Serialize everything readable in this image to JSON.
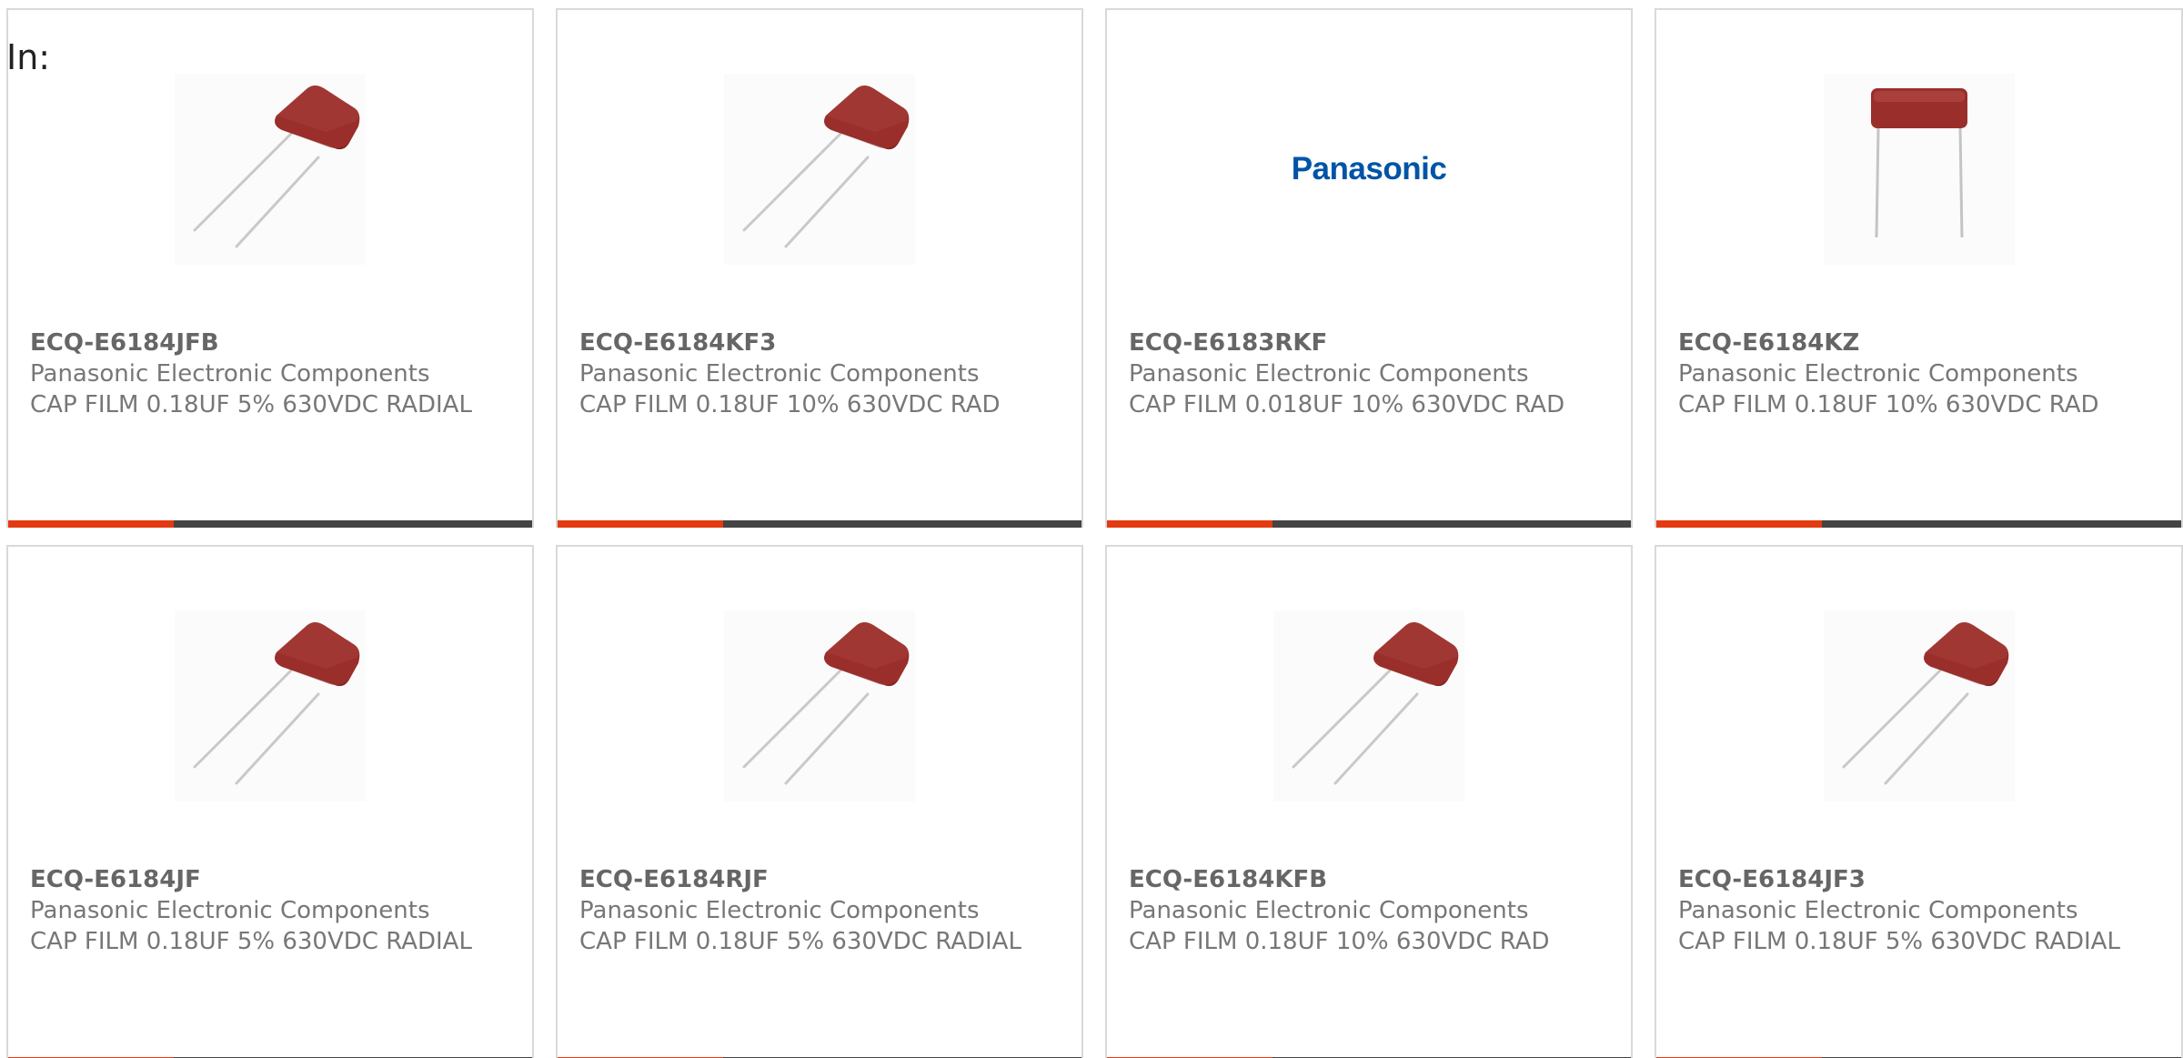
{
  "header": {
    "in_label": "In:"
  },
  "brand_logo_text": "Panasonic",
  "colors": {
    "accent": "#e43a12",
    "bar": "#444444",
    "capacitor_body": "#9a2e2b",
    "logo_blue": "#0054a6"
  },
  "products": [
    {
      "part_number": "ECQ-E6184JFB",
      "manufacturer": "Panasonic Electronic Components",
      "description": "CAP FILM 0.18UF 5% 630VDC RADIAL",
      "image": "capacitor-angled-icon"
    },
    {
      "part_number": "ECQ-E6184KF3",
      "manufacturer": "Panasonic Electronic Components",
      "description": "CAP FILM 0.18UF 10% 630VDC RAD",
      "image": "capacitor-angled-icon"
    },
    {
      "part_number": "ECQ-E6183RKF",
      "manufacturer": "Panasonic Electronic Components",
      "description": "CAP FILM 0.018UF 10% 630VDC RAD",
      "image": "panasonic-logo"
    },
    {
      "part_number": "ECQ-E6184KZ",
      "manufacturer": "Panasonic Electronic Components",
      "description": "CAP FILM 0.18UF 10% 630VDC RAD",
      "image": "capacitor-front-icon"
    },
    {
      "part_number": "ECQ-E6184JF",
      "manufacturer": "Panasonic Electronic Components",
      "description": "CAP FILM 0.18UF 5% 630VDC RADIAL",
      "image": "capacitor-angled-icon"
    },
    {
      "part_number": "ECQ-E6184RJF",
      "manufacturer": "Panasonic Electronic Components",
      "description": "CAP FILM 0.18UF 5% 630VDC RADIAL",
      "image": "capacitor-angled-icon"
    },
    {
      "part_number": "ECQ-E6184KFB",
      "manufacturer": "Panasonic Electronic Components",
      "description": "CAP FILM 0.18UF 10% 630VDC RAD",
      "image": "capacitor-angled-icon"
    },
    {
      "part_number": "ECQ-E6184JF3",
      "manufacturer": "Panasonic Electronic Components",
      "description": "CAP FILM 0.18UF 5% 630VDC RADIAL",
      "image": "capacitor-angled-icon"
    }
  ]
}
